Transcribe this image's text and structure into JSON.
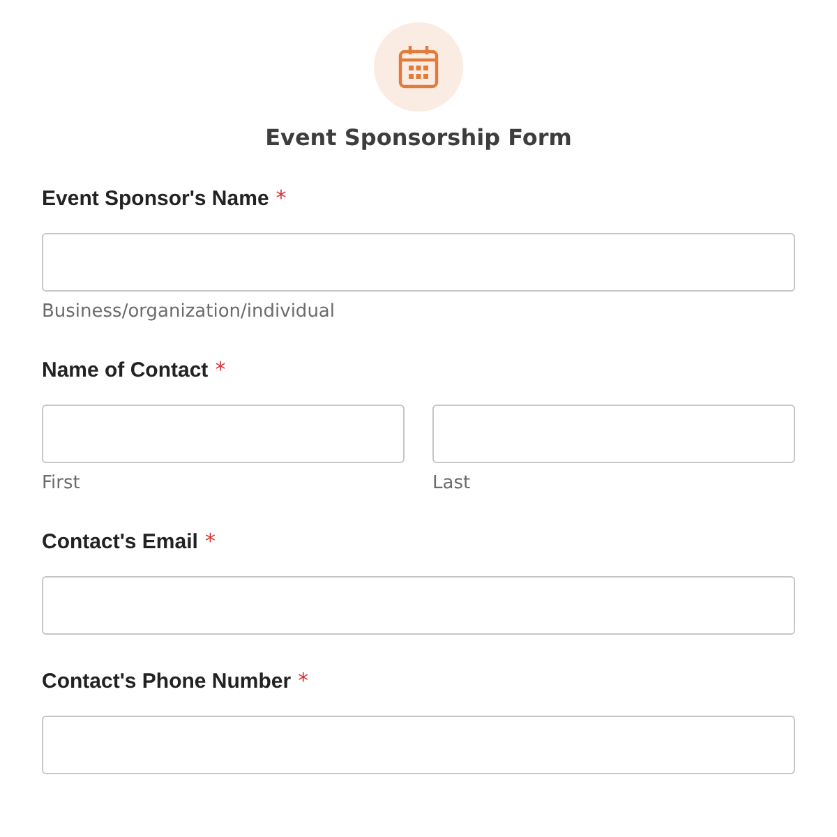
{
  "form": {
    "title": "Event Sponsorship Form"
  },
  "fields": [
    {
      "kind": "single",
      "label": "Event Sponsor's Name",
      "required_mark": "*",
      "sublabels": [
        "Business/organization/individual"
      ]
    },
    {
      "kind": "split",
      "label": "Name of Contact",
      "required_mark": "*",
      "sublabels": [
        "First",
        "Last"
      ]
    },
    {
      "kind": "single",
      "label": "Contact's Email",
      "required_mark": "*"
    },
    {
      "kind": "single",
      "label": "Contact's Phone Number",
      "required_mark": "*"
    }
  ]
}
